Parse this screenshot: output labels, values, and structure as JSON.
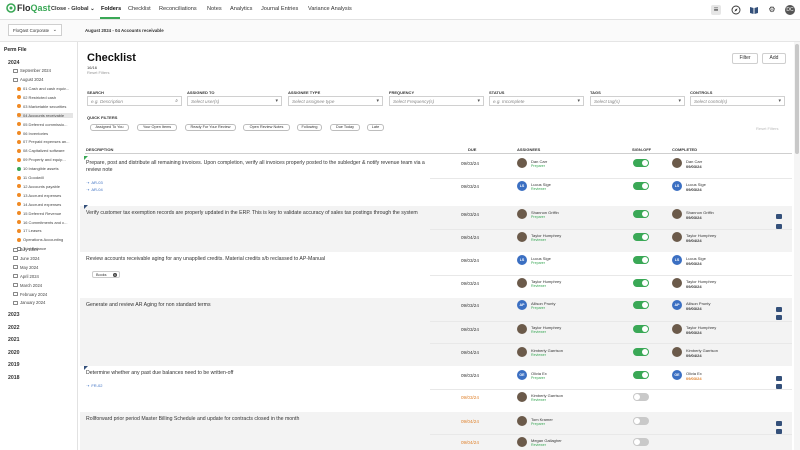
{
  "brand": {
    "name_a": "Flo",
    "name_b": "Qast",
    "accent": "#3aa856"
  },
  "workspace": "Close - Global",
  "nav": {
    "tabs": [
      "Folders",
      "Checklist",
      "Reconciliations",
      "Notes",
      "Analytics",
      "Journal Entries",
      "Variance Analysis"
    ],
    "active": "Folders"
  },
  "top_icons": [
    "list-icon",
    "compass-icon",
    "book-icon",
    "gear-icon"
  ],
  "user_initials": "DC",
  "entity": "FloQast Corporate",
  "period_path": "August 2024 - 04 Accounts receivable",
  "sidebar": {
    "title": "Perm File",
    "year_2024": "2024",
    "months_top": [
      "September 2024",
      "August 2024"
    ],
    "items": [
      {
        "label": "01 Cash and cash equiv...",
        "status": "orange"
      },
      {
        "label": "02 Restricted cash",
        "status": "orange"
      },
      {
        "label": "03 Marketable securities",
        "status": "orange"
      },
      {
        "label": "04 Accounts receivable",
        "status": "orange",
        "selected": true
      },
      {
        "label": "05 Deferred commissio...",
        "status": "orange"
      },
      {
        "label": "06 Inventories",
        "status": "orange"
      },
      {
        "label": "07 Prepaid expenses an...",
        "status": "orange"
      },
      {
        "label": "08 Capitalized software",
        "status": "orange"
      },
      {
        "label": "09 Property and equip...",
        "status": "orange"
      },
      {
        "label": "10 Intangible assets",
        "status": "green"
      },
      {
        "label": "11 Goodwill",
        "status": "orange"
      },
      {
        "label": "12 Accounts payable",
        "status": "orange"
      },
      {
        "label": "13 Accrued expenses",
        "status": "orange"
      },
      {
        "label": "14 Accrued expenses",
        "status": "orange"
      },
      {
        "label": "15 Deferred Revenue",
        "status": "orange"
      },
      {
        "label": "16 Commitments and c...",
        "status": "orange"
      },
      {
        "label": "17 Leases",
        "status": "orange"
      },
      {
        "label": "Operations Accounting",
        "status": "orange"
      },
      {
        "label": "Trial Balance",
        "status": "file"
      }
    ],
    "months_bottom": [
      "July 2024",
      "June 2024",
      "May 2024",
      "April 2024",
      "March 2024",
      "February 2024",
      "January 2024"
    ],
    "years": [
      "2023",
      "2022",
      "2021",
      "2020",
      "2019",
      "2018"
    ]
  },
  "page": {
    "title": "Checklist",
    "count": "16/16",
    "reset_filters": "Reset Filters",
    "filter_btn": "Filter",
    "add_btn": "Add"
  },
  "filters": {
    "search": {
      "label": "SEARCH",
      "placeholder": "e.g. Description"
    },
    "assigned_to": {
      "label": "ASSIGNED TO",
      "value": "Select user(s)"
    },
    "assignee_type": {
      "label": "ASSIGNEE TYPE",
      "value": "Select assignee type"
    },
    "frequency": {
      "label": "FREQUENCY",
      "value": "Select Frequency(s)"
    },
    "status": {
      "label": "STATUS",
      "value": "e.g. Incomplete"
    },
    "tags": {
      "label": "TAGS",
      "value": "Select tag(s)"
    },
    "controls": {
      "label": "CONTROLS",
      "value": "Select control(s)"
    }
  },
  "quick_filters": {
    "label": "QUICK FILTERS",
    "items": [
      "Assigned To You",
      "Your Open Items",
      "Ready For Your Review",
      "Open Review Notes",
      "Following",
      "Due Today",
      "Late"
    ],
    "reset": "Reset Filters"
  },
  "table": {
    "headers": {
      "description": "DESCRIPTION",
      "due": "DUE",
      "assignees": "ASSIGNEES",
      "signoff": "SIGN-OFF",
      "completed": "COMPLETED"
    },
    "rows": [
      {
        "desc": "Prepare, post and distribute all remaining invoices. Upon completion, verify all invoices properly posted to the subledger & notify revenue team via a review note",
        "refs": [
          "AR-03",
          "AR-04"
        ]
      },
      {
        "desc": "Verify customer tax exemption records are properly updated in the ERP. This is key to validate accuracy of sales tax postings through the system"
      },
      {
        "desc": "Review accounts receivable aging for any unapplied credits. Material credits s/b reclassed to AP-Manual",
        "tag": "Books",
        "tag_count": "1"
      },
      {
        "desc": "Generate and review AR Aging for non standard terms"
      },
      {
        "desc": "Determine whether any past due balances need to be written-off",
        "refs": [
          "FR-02"
        ]
      },
      {
        "desc": "Rollforward prior period Master Billing Schedule and update for contracts closed in the month"
      }
    ],
    "assignees": [
      {
        "name": "Dan Carr",
        "role": "Preparer",
        "due": "09/03/24",
        "done_name": "Dan Carr",
        "done_date": "09/03/24",
        "on": true
      },
      {
        "name": "Lucus Sige",
        "initials": "LS",
        "role": "Reviewer",
        "due": "09/03/24",
        "done_name": "Lucus Sige",
        "done_date": "09/03/24",
        "on": true
      },
      {
        "name": "Shannon Griffin",
        "role": "Preparer",
        "due": "09/03/24",
        "done_name": "Shannon Griffin",
        "done_date": "09/03/24",
        "on": true
      },
      {
        "name": "Taylor Humphrey",
        "role": "Reviewer",
        "due": "09/04/24",
        "done_name": "Taylor Humphrey",
        "done_date": "09/04/24",
        "on": true
      },
      {
        "name": "Lucus Sige",
        "initials": "LS",
        "role": "Preparer",
        "due": "09/03/24",
        "done_name": "Lucus Sige",
        "done_date": "09/03/24",
        "on": true
      },
      {
        "name": "Taylor Humphrey",
        "role": "Reviewer",
        "due": "09/03/24",
        "done_name": "Taylor Humphrey",
        "done_date": "09/03/24",
        "on": true
      },
      {
        "name": "Allison Prunty",
        "initials": "AP",
        "role": "Preparer",
        "due": "09/03/24",
        "done_name": "Allison Prunty",
        "done_date": "09/03/24",
        "on": true
      },
      {
        "name": "Taylor Humphrey",
        "role": "Reviewer",
        "due": "09/03/24",
        "done_name": "Taylor Humphrey",
        "done_date": "09/03/24",
        "on": true
      },
      {
        "name": "Kimberly Garrison",
        "role": "Reviewer",
        "due": "09/04/24",
        "done_name": "Kimberly Garrison",
        "done_date": "09/04/24",
        "on": true
      },
      {
        "name": "Olivia Ex",
        "initials": "OE",
        "role": "Preparer",
        "due": "09/03/24",
        "done_name": "Olivia Ex",
        "done_date": "09/03/24",
        "on": true
      },
      {
        "name": "Kimberly Garrison",
        "role": "Reviewer",
        "due": "09/03/24",
        "on": false
      },
      {
        "name": "Tom Kramer",
        "role": "Preparer",
        "due": "09/04/24",
        "on": false
      },
      {
        "name": "Megan Gallagher",
        "role": "Reviewer",
        "due": "09/04/24",
        "on": false
      }
    ]
  }
}
